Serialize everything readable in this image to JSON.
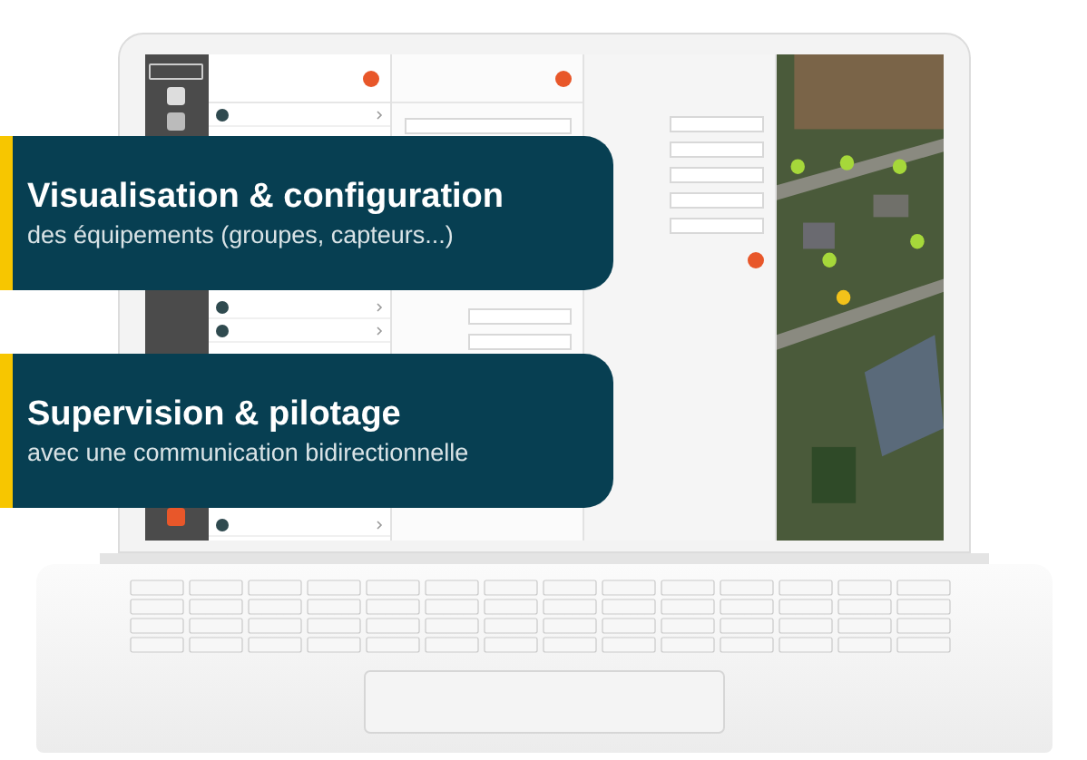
{
  "callouts": [
    {
      "title": "Visualisation & configuration",
      "subtitle": "des équipements (groupes, capteurs...)"
    },
    {
      "title": "Supervision & pilotage",
      "subtitle": "avec une communication bidirectionnelle"
    }
  ]
}
